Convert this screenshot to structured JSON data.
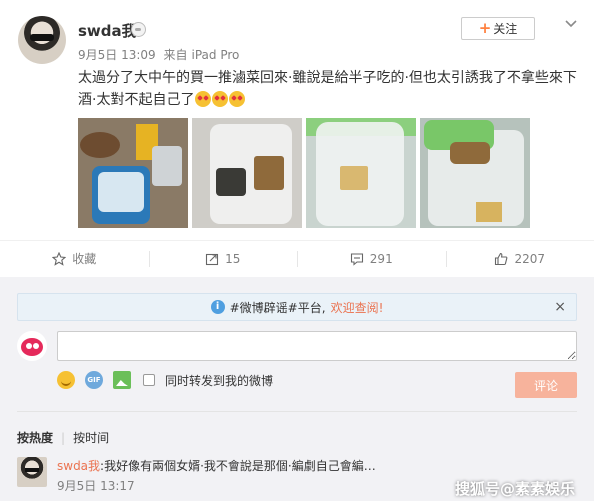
{
  "post": {
    "username": "swda我",
    "date": "9月5日 13:09",
    "source_prefix": "来自",
    "source": "iPad Pro",
    "follow_label": "关注",
    "text": "太過分了大中午的買一推滷菜回來·雖說是給半子吃的·但也太引誘我了不拿些來下酒·太對不起自己了",
    "emojis": [
      "heart-eyes-emoji",
      "heart-eyes-emoji",
      "heart-eyes-emoji"
    ],
    "photos": [
      {
        "alt": "food-photo-1"
      },
      {
        "alt": "food-photo-2"
      },
      {
        "alt": "food-photo-3"
      },
      {
        "alt": "food-photo-4"
      }
    ]
  },
  "actions": {
    "favorite_label": "收藏",
    "repost_count": "15",
    "comment_count": "291",
    "like_count": "2207"
  },
  "comments": {
    "notice_prefix": "#微博辟谣#平台,",
    "notice_highlight": "欢迎查阅!",
    "notice_close": "×",
    "input_value": "",
    "repost_option": "同时转发到我的微博",
    "submit_label": "评论",
    "sort_hot": "按热度",
    "sort_time": "按时间",
    "items": [
      {
        "author": "swda我",
        "text": ":我好像有兩個女婿·我不會說是那個·編劇自己會編…",
        "time": "9月5日 13:17"
      }
    ]
  },
  "watermark": "搜狐号@素素娛乐",
  "colors": {
    "accent_orange": "#eb7350",
    "button_disabled": "#f7b39c",
    "notice_bg": "#eaf2f8"
  }
}
